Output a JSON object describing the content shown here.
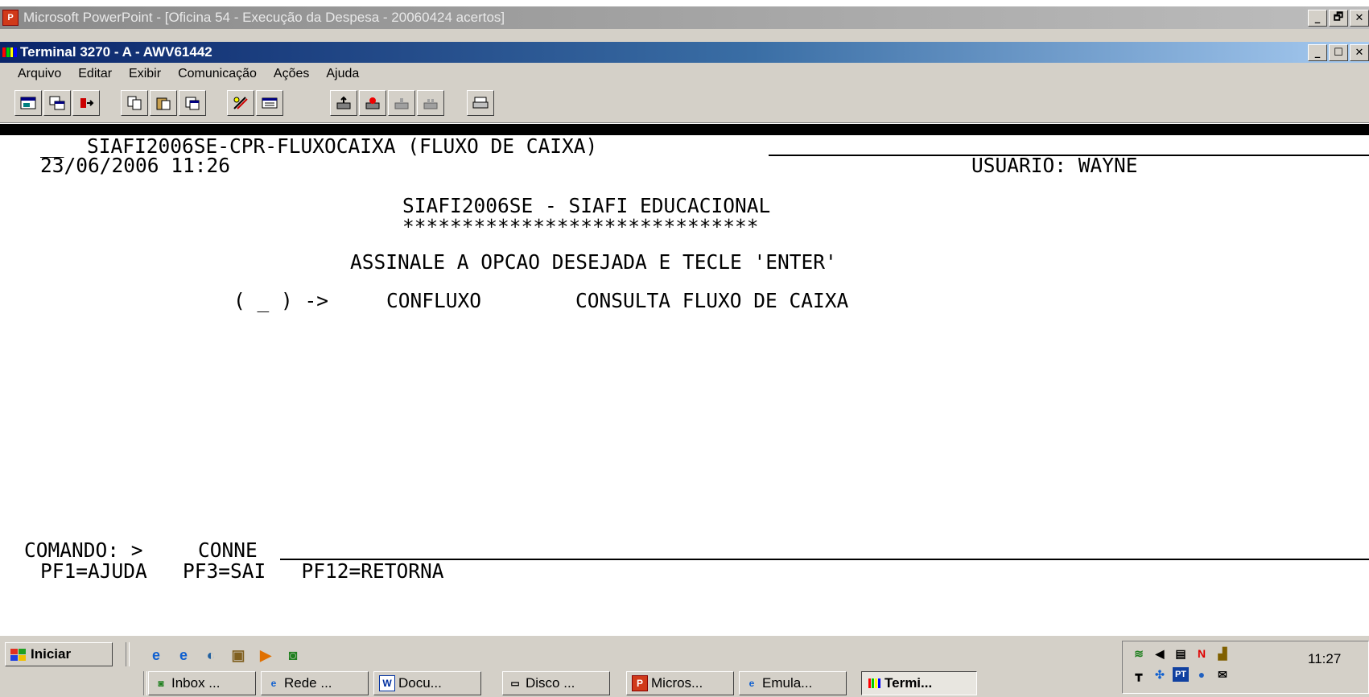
{
  "outer_window": {
    "title": "Microsoft PowerPoint - [Oficina 54 - Execução da Despesa - 20060424 acertos]",
    "buttons": [
      "_",
      "🗗",
      "✕"
    ]
  },
  "terminal_window": {
    "title": "Terminal 3270 - A - AWV61442",
    "buttons": [
      "_",
      "☐",
      "✕"
    ]
  },
  "menu": {
    "items": [
      "Arquivo",
      "Editar",
      "Exibir",
      "Comunicação",
      "Ações",
      "Ajuda"
    ]
  },
  "toolbar": {
    "icons": [
      "new-session-icon",
      "open-session-icon",
      "disconnect-icon",
      "copy-icon",
      "paste-icon",
      "paste-special-icon",
      "settings-icon",
      "keyboard-map-icon",
      "send-file-icon",
      "record-macro-icon",
      "play-macro-icon",
      "stop-macro-icon",
      "print-icon"
    ]
  },
  "screen": {
    "header_field": "__",
    "header_title": "SIAFI2006SE-CPR-FLUXOCAIXA (FLUXO DE CAIXA)",
    "datetime": "23/06/2006 11:26",
    "user": "USUARIO: WAYNE",
    "system_title": "SIAFI2006SE - SIAFI EDUCACIONAL",
    "stars": "******************************",
    "instruction": "ASSINALE A OPCAO DESEJADA E TECLE 'ENTER'",
    "option_marker": "( _ ) ->",
    "option_code": "CONFLUXO",
    "option_desc": "CONSULTA FLUXO DE CAIXA",
    "command_label": "COMANDO: >",
    "command_value": "CONNE",
    "pf_keys": "PF1=AJUDA   PF3=SAI   PF12=RETORNA"
  },
  "taskbar": {
    "start_label": "Iniciar",
    "quicklaunch": [
      "ie-icon",
      "ie2-icon",
      "outlook-icon",
      "notepad-icon",
      "media-icon",
      "powerpoint-icon"
    ],
    "tasks": [
      {
        "label": "Inbox ...",
        "icon": "outlook-icon"
      },
      {
        "label": "Rede ...",
        "icon": "ie-icon"
      },
      {
        "label": "Docu...",
        "icon": "word-icon"
      },
      {
        "label": "Disco ...",
        "icon": "disk-icon"
      },
      {
        "label": "Micros...",
        "icon": "powerpoint-icon"
      },
      {
        "label": "Emula...",
        "icon": "ie-icon"
      },
      {
        "label": "Termi...",
        "icon": "terminal-icon"
      }
    ],
    "clock": "11:27",
    "tray_pt": "PT"
  },
  "colors": {
    "title_active_start": "#0a246a",
    "title_active_end": "#a6caf0",
    "face": "#d4d0c8"
  }
}
